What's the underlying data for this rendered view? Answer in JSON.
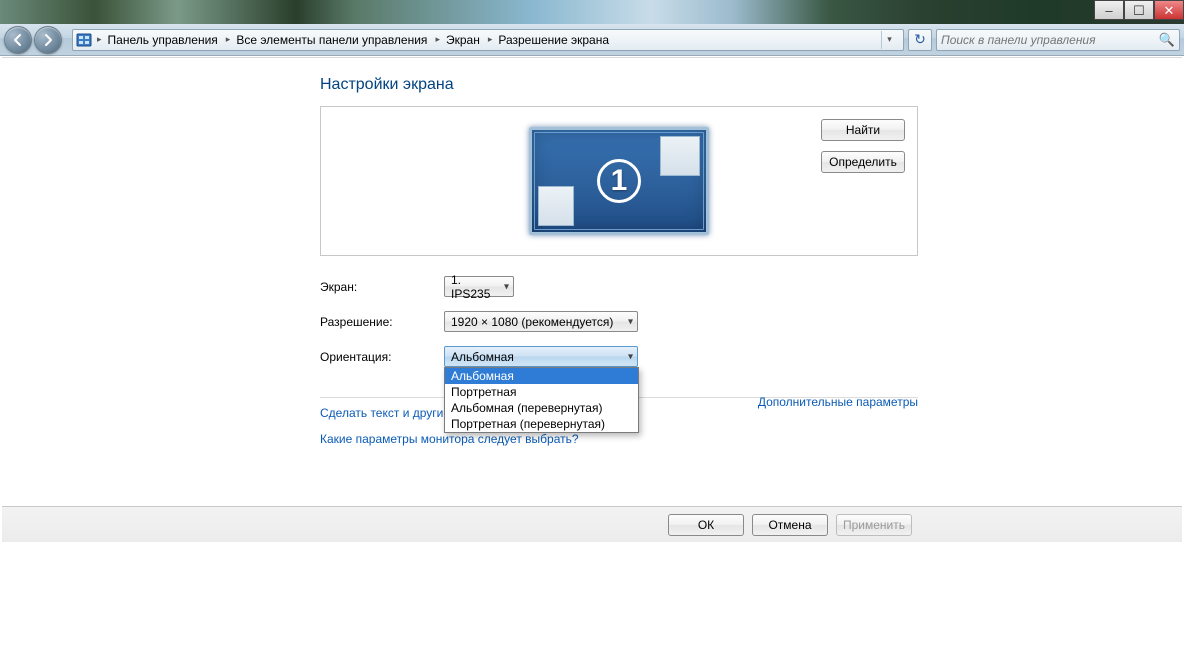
{
  "window_controls": {
    "minimize": "–",
    "maximize": "☐",
    "close": "✕"
  },
  "breadcrumb": {
    "items": [
      "Панель управления",
      "Все элементы панели управления",
      "Экран",
      "Разрешение экрана"
    ]
  },
  "search": {
    "placeholder": "Поиск в панели управления"
  },
  "page": {
    "title": "Настройки экрана",
    "monitor_number": "1",
    "detect_label": "Найти",
    "identify_label": "Определить"
  },
  "form": {
    "display_label": "Экран:",
    "display_value": "1. IPS235",
    "resolution_label": "Разрешение:",
    "resolution_value": "1920 × 1080 (рекомендуется)",
    "orientation_label": "Ориентация:",
    "orientation_value": "Альбомная",
    "orientation_options": [
      "Альбомная",
      "Портретная",
      "Альбомная (перевернутая)",
      "Портретная (перевернутая)"
    ]
  },
  "links": {
    "advanced": "Дополнительные параметры",
    "text_size": "Сделать текст и другие",
    "which_settings": "Какие параметры монитора следует выбрать?"
  },
  "footer": {
    "ok": "ОК",
    "cancel": "Отмена",
    "apply": "Применить"
  }
}
